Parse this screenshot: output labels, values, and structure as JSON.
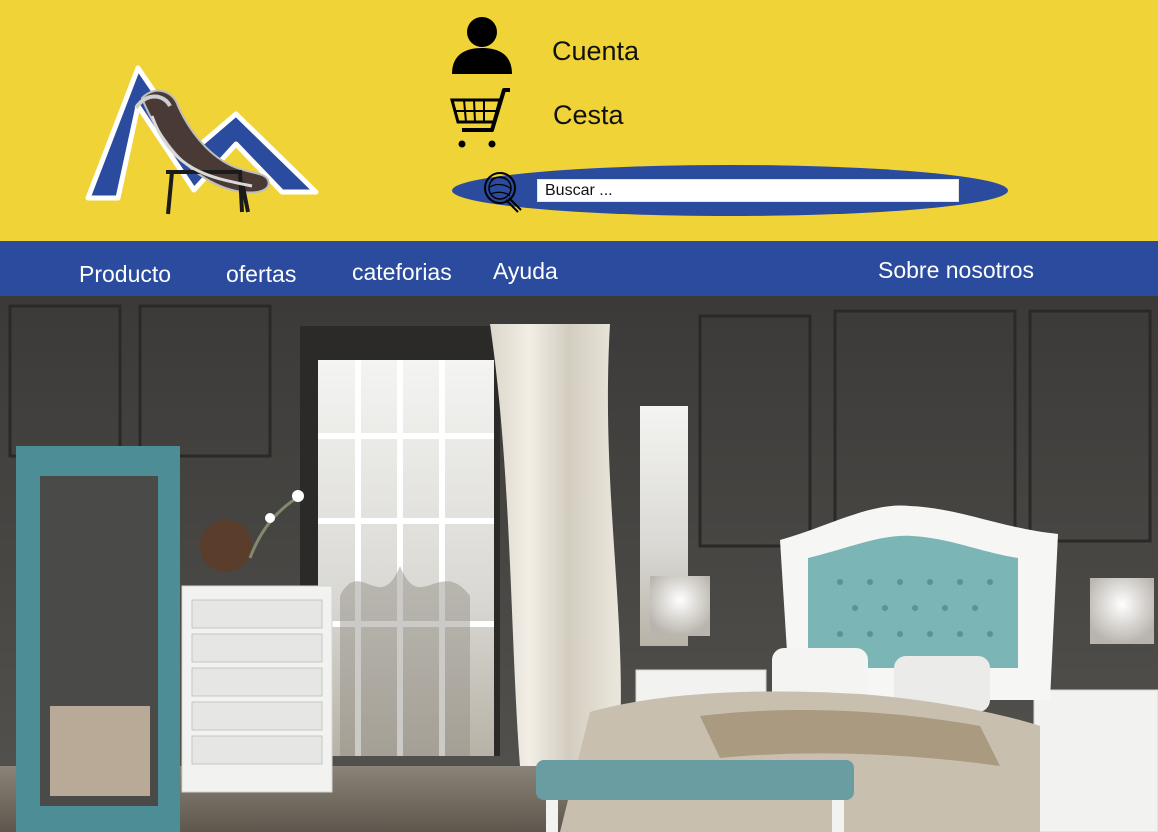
{
  "header": {
    "account_label": "Cuenta",
    "cart_label": "Cesta",
    "search_placeholder": "Buscar ...",
    "icons": [
      "logo-chaise-lounge",
      "user-icon",
      "shopping-cart-icon",
      "search-icon"
    ]
  },
  "nav": {
    "items": [
      {
        "label": "Producto"
      },
      {
        "label": "ofertas"
      },
      {
        "label": "cateforias"
      },
      {
        "label": "Ayuda"
      },
      {
        "label": "Sobre nosotros"
      }
    ]
  },
  "colors": {
    "header_bg": "#f0d337",
    "nav_bg": "#2b4c9e",
    "search_bg": "#2b4c9e",
    "nav_text": "#ffffff"
  }
}
